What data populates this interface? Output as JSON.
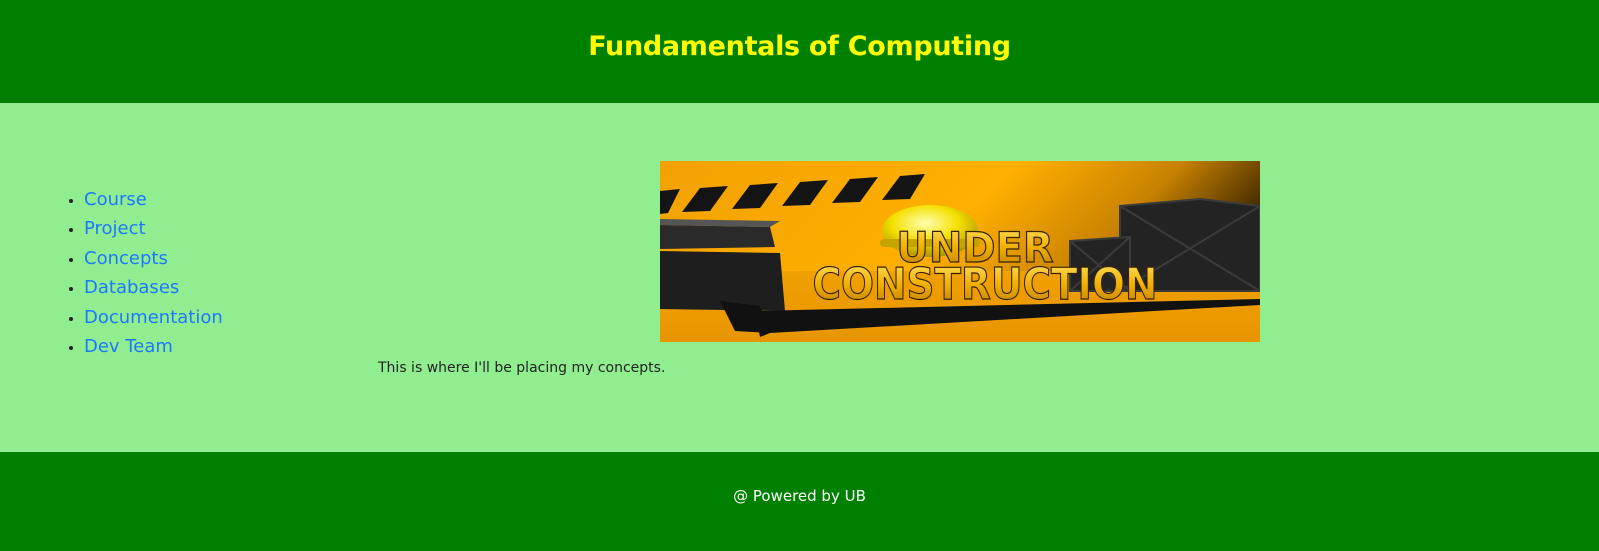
{
  "header": {
    "title": "Fundamentals of Computing"
  },
  "nav": {
    "items": [
      {
        "label": "Course"
      },
      {
        "label": "Project"
      },
      {
        "label": "Concepts"
      },
      {
        "label": "Databases"
      },
      {
        "label": "Documentation"
      },
      {
        "label": "Dev Team"
      }
    ]
  },
  "main": {
    "banner": {
      "line1": "UNDER",
      "line2": "CONSTRUCTION"
    },
    "text": "This is where I'll be placing my concepts."
  },
  "footer": {
    "text": "@ Powered by UB"
  },
  "colors": {
    "header_bg": "#008000",
    "header_title": "#FFFF00",
    "page_bg": "#90EE90",
    "link": "#1E78FF",
    "footer_text": "#FFFFFF"
  }
}
